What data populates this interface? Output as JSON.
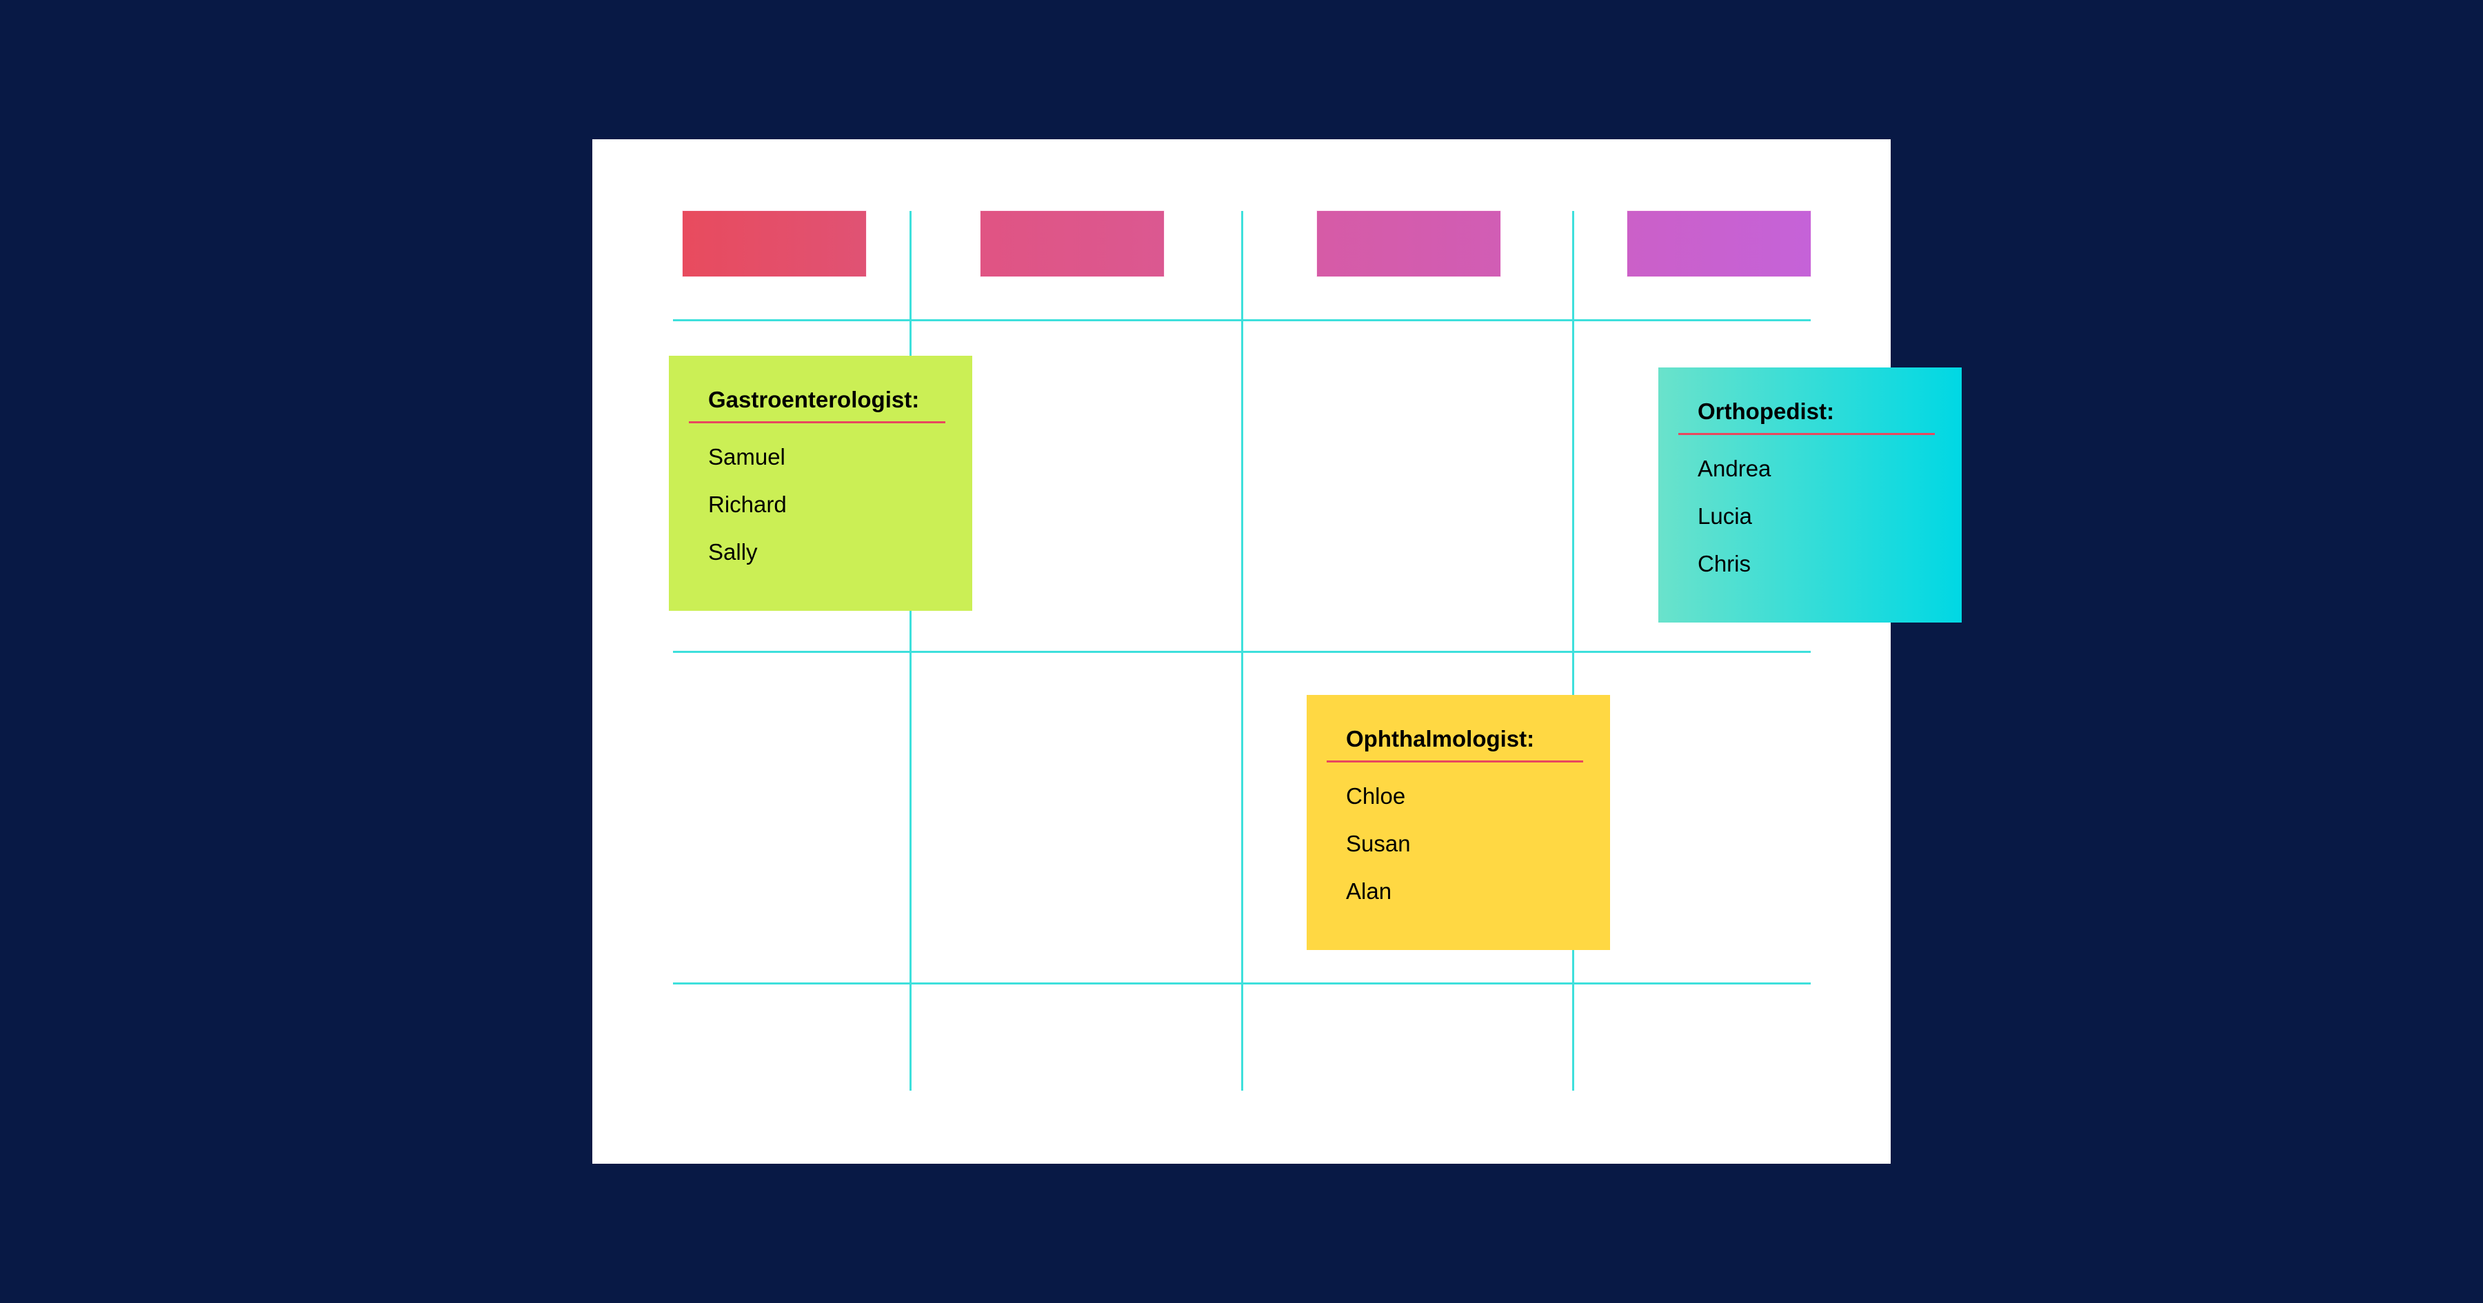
{
  "board": {
    "background_color": "#081945",
    "board_color": "#ffffff",
    "grid_color": "#3ee0dc",
    "columns": 4,
    "rows": 3,
    "column_headers": [
      {
        "color_start": "#e84b5e",
        "color_end": "#e05274"
      },
      {
        "color_start": "#e05483",
        "color_end": "#db5891"
      },
      {
        "color_start": "#d65ba6",
        "color_end": "#d15db5"
      },
      {
        "color_start": "#cb60c8",
        "color_end": "#c562d8"
      }
    ]
  },
  "notes": [
    {
      "title": "Gastroenterologist:",
      "names": [
        "Samuel",
        "Richard",
        "Sally"
      ],
      "color_start": "#cbef55",
      "color_end": "#cbef55",
      "rule_color": "#e8485e"
    },
    {
      "title": "Orthopedist:",
      "names": [
        "Andrea",
        "Lucia",
        "Chris"
      ],
      "color_start": "#6ae2cb",
      "color_end": "#00d8e4",
      "rule_color": "#e8485e"
    },
    {
      "title": "Ophthalmologist:",
      "names": [
        "Chloe",
        "Susan",
        "Alan"
      ],
      "color_start": "#ffd843",
      "color_end": "#ffd843",
      "rule_color": "#e8485e"
    }
  ]
}
